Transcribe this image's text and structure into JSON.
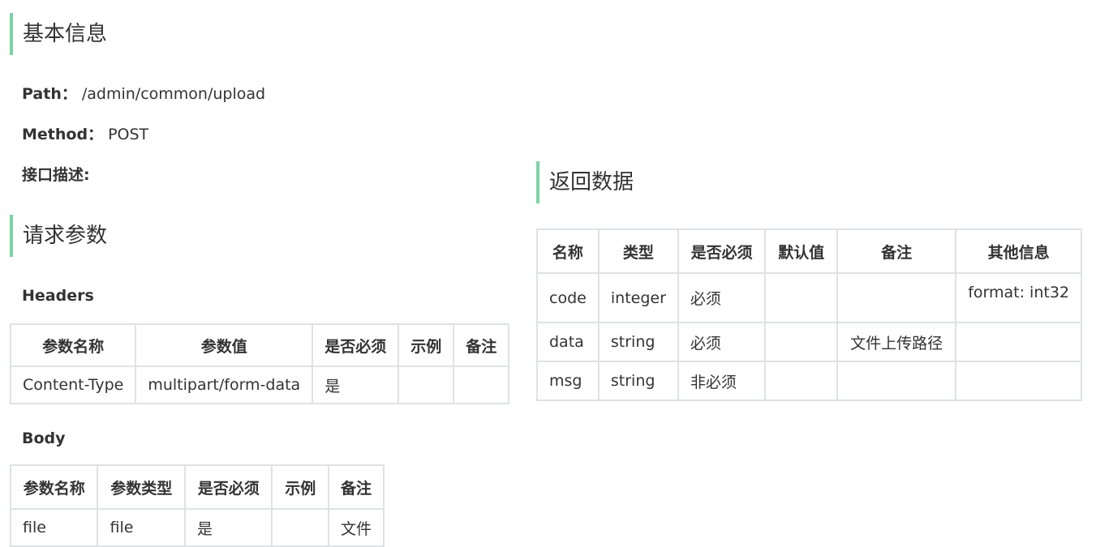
{
  "basic_info": {
    "heading": "基本信息",
    "path_label": "Path：",
    "path_value": "/admin/common/upload",
    "method_label": "Method：",
    "method_value": "POST",
    "desc_label": "接口描述:"
  },
  "request": {
    "heading": "请求参数",
    "headers_label": "Headers",
    "headers_table": {
      "columns": [
        "参数名称",
        "参数值",
        "是否必须",
        "示例",
        "备注"
      ],
      "rows": [
        [
          "Content-Type",
          "multipart/form-data",
          "是",
          "",
          ""
        ]
      ]
    },
    "body_label": "Body",
    "body_table": {
      "columns": [
        "参数名称",
        "参数类型",
        "是否必须",
        "示例",
        "备注"
      ],
      "rows": [
        [
          "file",
          "file",
          "是",
          "",
          "文件"
        ]
      ]
    }
  },
  "response": {
    "heading": "返回数据",
    "table": {
      "columns": [
        "名称",
        "类型",
        "是否必须",
        "默认值",
        "备注",
        "其他信息"
      ],
      "rows": [
        [
          "code",
          "integer",
          "必须",
          "",
          "",
          "format: int32"
        ],
        [
          "data",
          "string",
          "必须",
          "",
          "文件上传路径",
          ""
        ],
        [
          "msg",
          "string",
          "非必须",
          "",
          "",
          ""
        ]
      ]
    }
  }
}
